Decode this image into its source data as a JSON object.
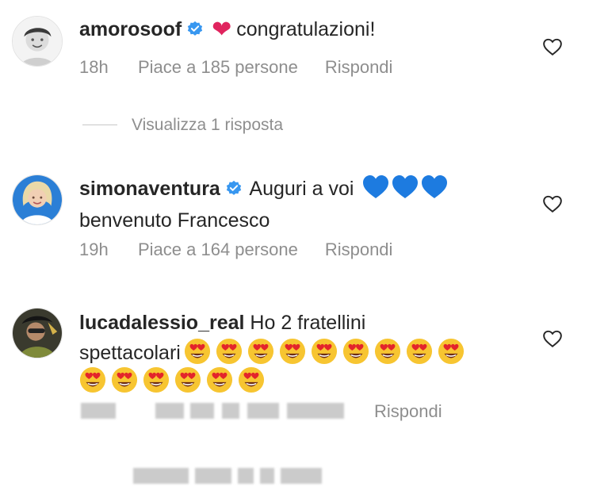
{
  "comments": [
    {
      "username": "amorosoof",
      "verified": true,
      "text": "congratulazioni!",
      "time": "18h",
      "likes": "Piace a 185 persone",
      "reply": "Rispondi"
    },
    {
      "username": "simonaventura",
      "verified": true,
      "text_line1": "Auguri a voi",
      "text_line2": "benvenuto Francesco",
      "time": "19h",
      "likes": "Piace a 164 persone",
      "reply": "Rispondi"
    },
    {
      "username": "lucadalessio_real",
      "verified": false,
      "text_line1": "Ho 2 fratellini",
      "text_line2": "spettacolari",
      "reply": "Rispondi"
    }
  ],
  "view_replies": "Visualizza 1 risposta",
  "icons": {
    "verified": "verified-badge-icon",
    "like": "heart-outline-icon",
    "emoji_red_heart": "❤",
    "emoji_blue_heart": "💙",
    "emoji_heart_eyes": "heart-eyes-emoji"
  },
  "colors": {
    "text": "#262626",
    "meta": "#8e8e8e",
    "verified": "#3897f0",
    "red_heart": "#e0245e",
    "blue_heart": "#1d7be0"
  }
}
